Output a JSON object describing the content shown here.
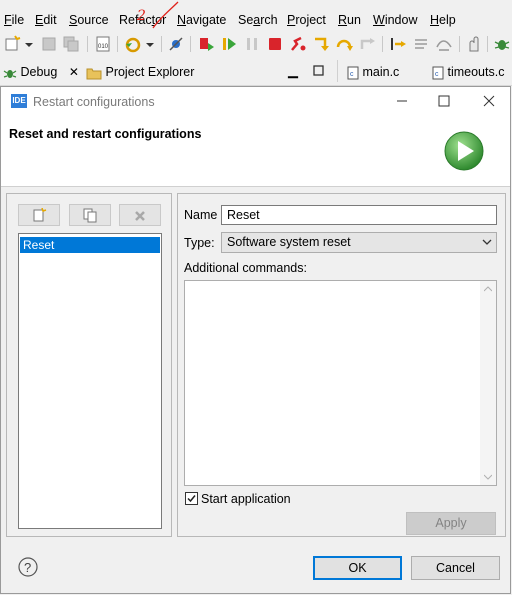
{
  "menu": {
    "items": [
      {
        "mnemonic": "F",
        "rest": "ile"
      },
      {
        "mnemonic": "E",
        "rest": "dit"
      },
      {
        "mnemonic": "S",
        "rest": "ource"
      },
      {
        "pre": "Refac",
        "mnemonic": "t",
        "rest": "or"
      },
      {
        "mnemonic": "N",
        "rest": "avigate"
      },
      {
        "pre": "Se",
        "mnemonic": "a",
        "rest": "rch"
      },
      {
        "mnemonic": "P",
        "rest": "roject"
      },
      {
        "mnemonic": "R",
        "rest": "un"
      },
      {
        "mnemonic": "W",
        "rest": "indow"
      },
      {
        "mnemonic": "H",
        "rest": "elp"
      }
    ]
  },
  "annotation": {
    "mark": "2",
    "color": "#e0231c"
  },
  "views": {
    "debug_tab": "Debug",
    "project_explorer_tab": "Project Explorer",
    "editor_tab_1": "main.c",
    "editor_tab_2": "timeouts.c"
  },
  "dialog": {
    "logo_text": "IDE",
    "window_title": "Restart configurations",
    "header_title": "Reset and restart configurations",
    "configurations": [
      "Reset"
    ],
    "name_label": "Name",
    "name_value": "Reset",
    "type_label": "Type:",
    "type_value": "Software system reset",
    "additional_commands_label": "Additional commands:",
    "additional_commands_value": "",
    "start_application_label": "Start application",
    "start_application_checked": true,
    "apply_button": "Apply",
    "ok_button": "OK",
    "cancel_button": "Cancel"
  },
  "colors": {
    "accent": "#0078d7",
    "play_green": "#3aa53a"
  }
}
